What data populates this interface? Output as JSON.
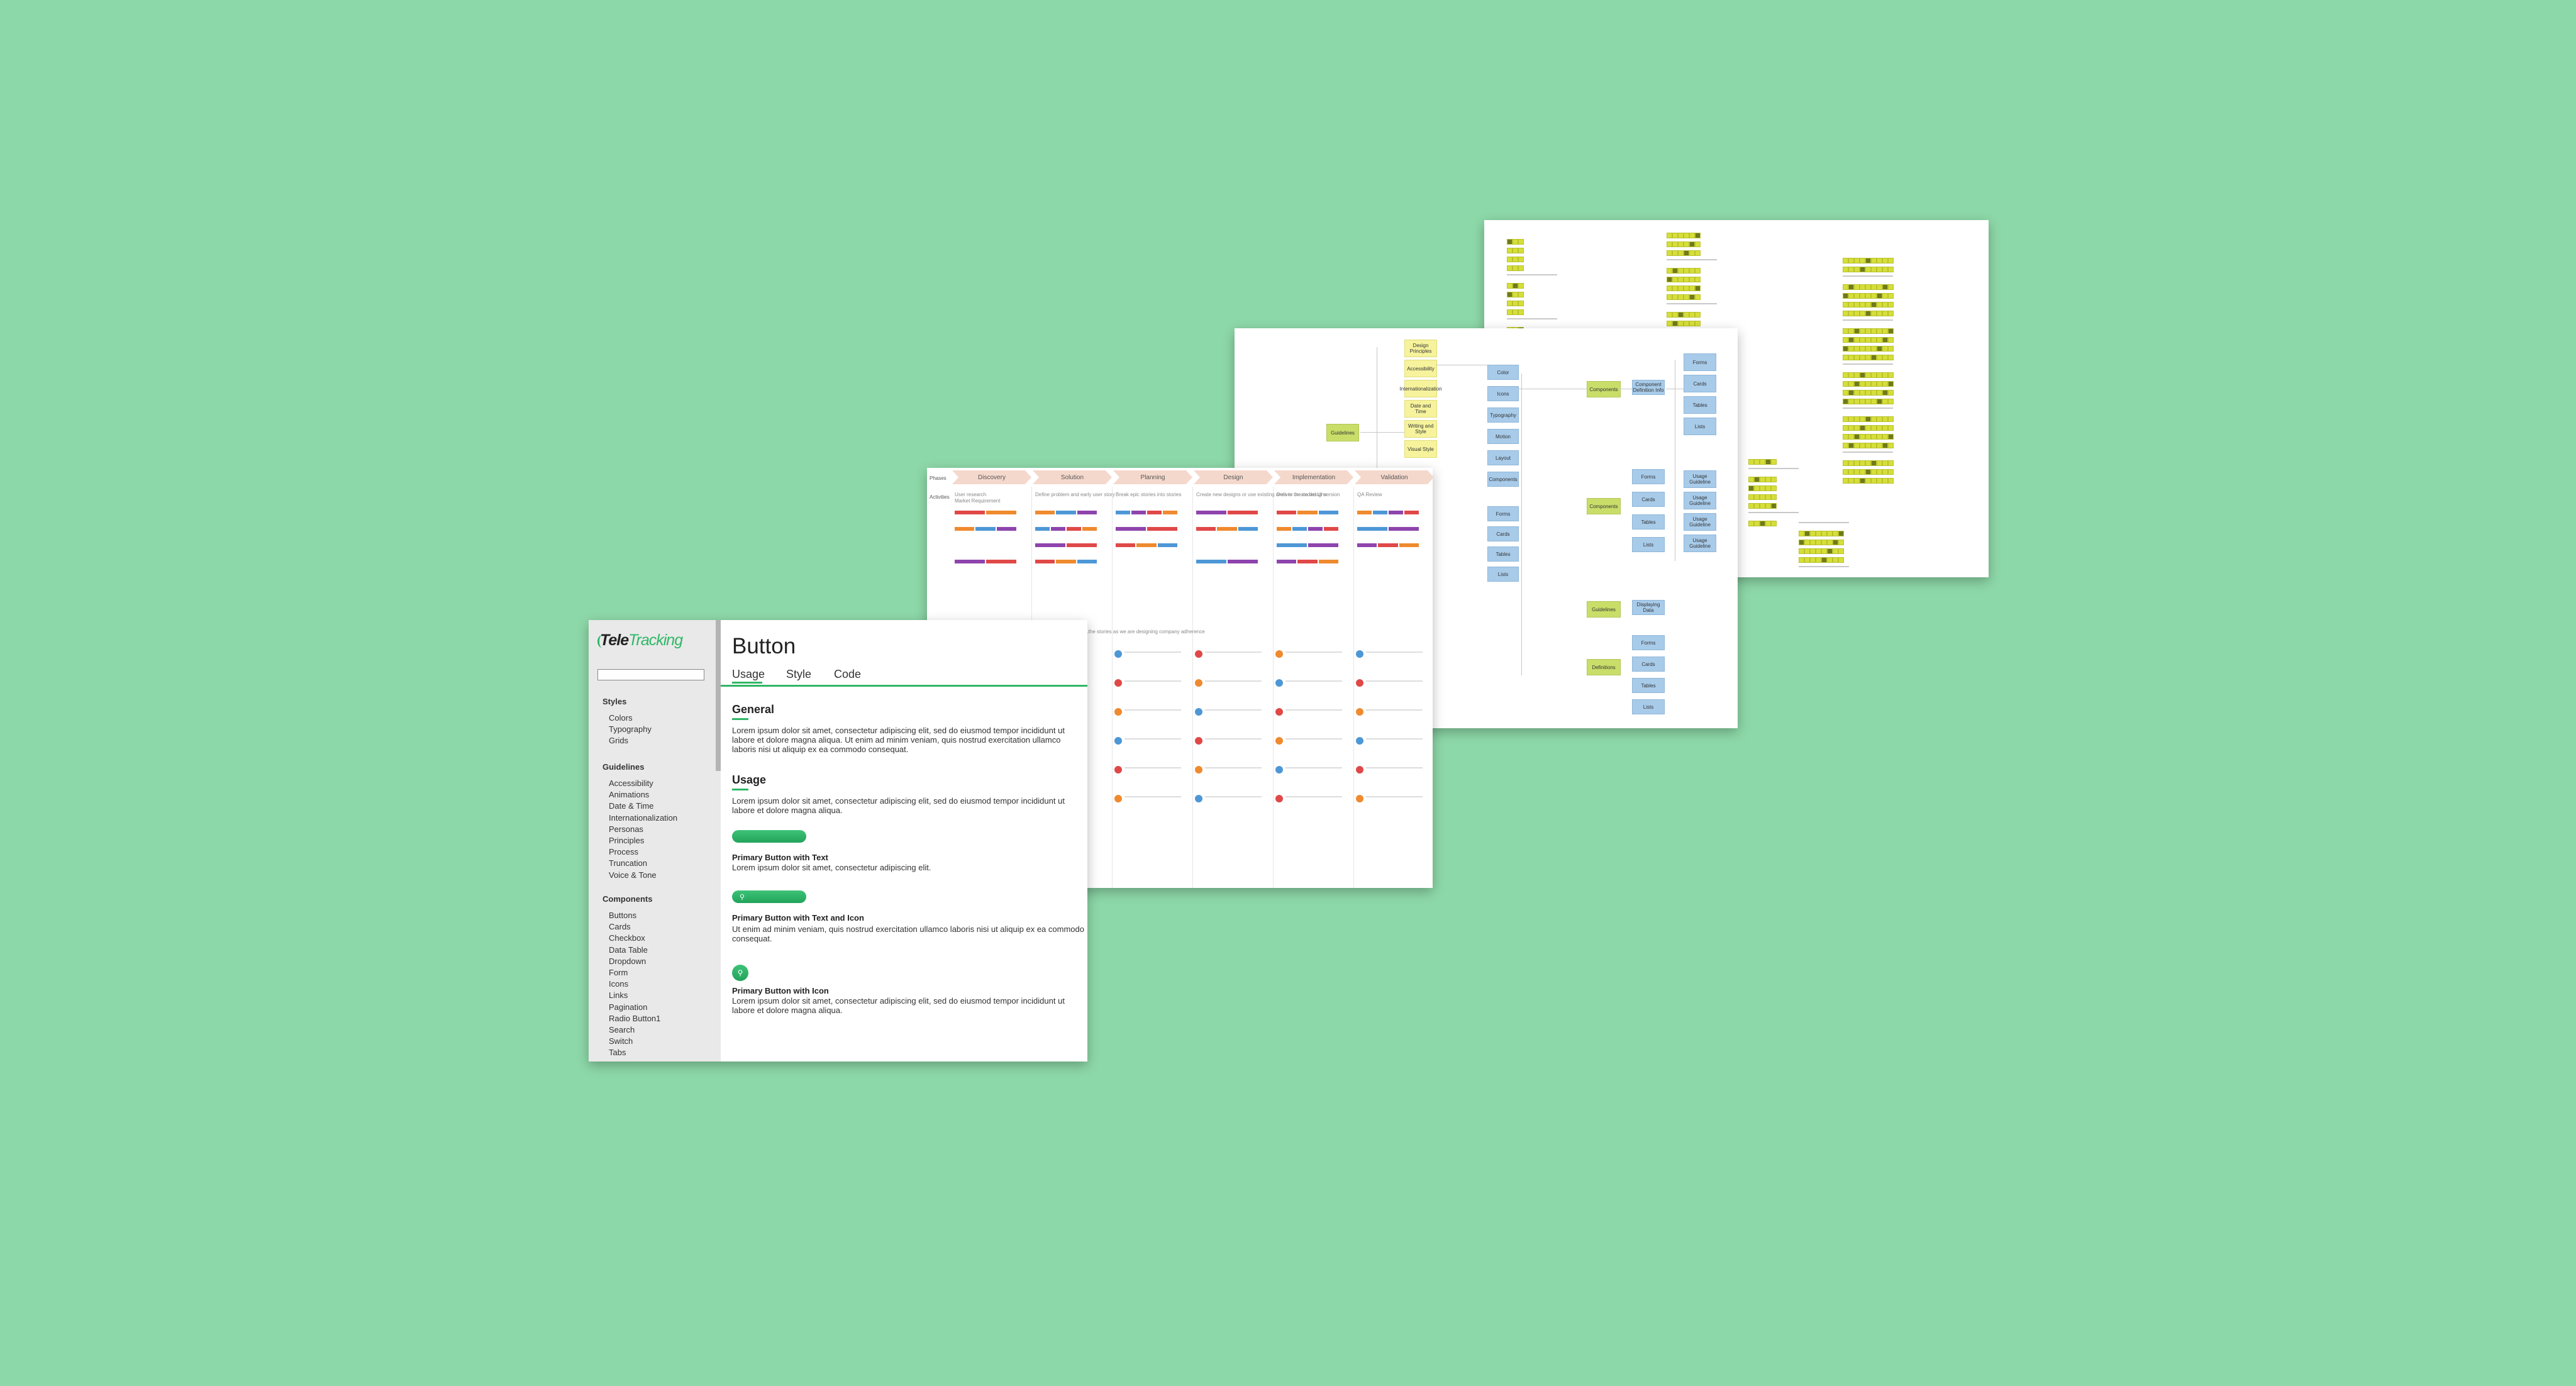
{
  "background_color": "#8dd8a8",
  "accent_color": "#2fb766",
  "journey": {
    "row_labels": [
      "Phases",
      "Activities"
    ],
    "phases": [
      "Discovery",
      "Solution",
      "Planning",
      "Design",
      "Implementation",
      "Validation"
    ],
    "note": "...the stories as we are designing company adherence",
    "activities": [
      [
        "User research",
        "Market Requirement"
      ],
      [
        "Define problem and early user story"
      ],
      [
        "Break epic stories into stories"
      ],
      [
        "Create new designs or use existing ones to create designs"
      ],
      [
        "Deliver the coded UI version"
      ],
      [
        "QA Review"
      ]
    ]
  },
  "map": {
    "root": "Guidelines",
    "yellow_nodes": [
      "Design Principles",
      "Accessibility",
      "Internationalization",
      "Date and Time",
      "Writing and Style",
      "Visual Style"
    ],
    "blue_col1": [
      "Color",
      "Icons",
      "Typography",
      "Motion",
      "Layout",
      "Components",
      "Forms",
      "Cards",
      "Tables",
      "Lists"
    ],
    "green_nodes": [
      "Components",
      "Components",
      "Guidelines",
      "Definitions"
    ],
    "blue_col2": [
      "Component Definition Info",
      "Forms",
      "Cards",
      "Tables",
      "Lists",
      "Displaying Data",
      "Forms",
      "Cards",
      "Tables",
      "Lists"
    ],
    "blue_col3": [
      "Forms",
      "Cards",
      "Tables",
      "Lists",
      "Usage Guideline",
      "Usage Guideline",
      "Usage Guideline",
      "Usage Guideline"
    ]
  },
  "doc": {
    "logo_main": "Tele",
    "logo_accent": "Tracking",
    "search": {
      "placeholder": "",
      "value": ""
    },
    "sidebar": {
      "styles_heading": "Styles",
      "styles": [
        "Colors",
        "Typography",
        "Grids"
      ],
      "guidelines_heading": "Guidelines",
      "guidelines": [
        "Accessibility",
        "Animations",
        "Date & Time",
        "Internationalization",
        "Personas",
        "Principles",
        "Process",
        "Truncation",
        "Voice & Tone"
      ],
      "components_heading": "Components",
      "components": [
        "Buttons",
        "Cards",
        "Checkbox",
        "Data Table",
        "Dropdown",
        "Form",
        "Icons",
        "Links",
        "Pagination",
        "Radio Button1",
        "Search",
        "Switch",
        "Tabs"
      ]
    },
    "title": "Button",
    "tabs": [
      "Usage",
      "Style",
      "Code"
    ],
    "general_heading": "General",
    "general_text": "Lorem ipsum dolor sit amet, consectetur adipiscing elit, sed do eiusmod tempor incididunt ut labore et dolore magna aliqua. Ut enim ad minim veniam, quis nostrud exercitation ullamco laboris nisi ut aliquip ex ea commodo consequat.",
    "usage_heading": "Usage",
    "usage_text": "Lorem ipsum dolor sit amet, consectetur adipiscing elit, sed do eiusmod tempor incididunt ut labore et dolore magna aliqua.",
    "example1_title": "Primary Button with Text",
    "example1_text": "Lorem ipsum dolor sit amet, consectetur adipiscing elit.",
    "example2_title": "Primary Button with Text and Icon",
    "example2_text": "Ut enim ad minim veniam, quis nostrud exercitation ullamco laboris nisi ut aliquip ex ea commodo consequat.",
    "example3_title": "Primary Button with Icon",
    "example3_text": "Lorem ipsum dolor sit amet, consectetur adipiscing elit, sed do eiusmod tempor incididunt ut labore et dolore magna aliqua.",
    "search_glyph": "⚲"
  }
}
